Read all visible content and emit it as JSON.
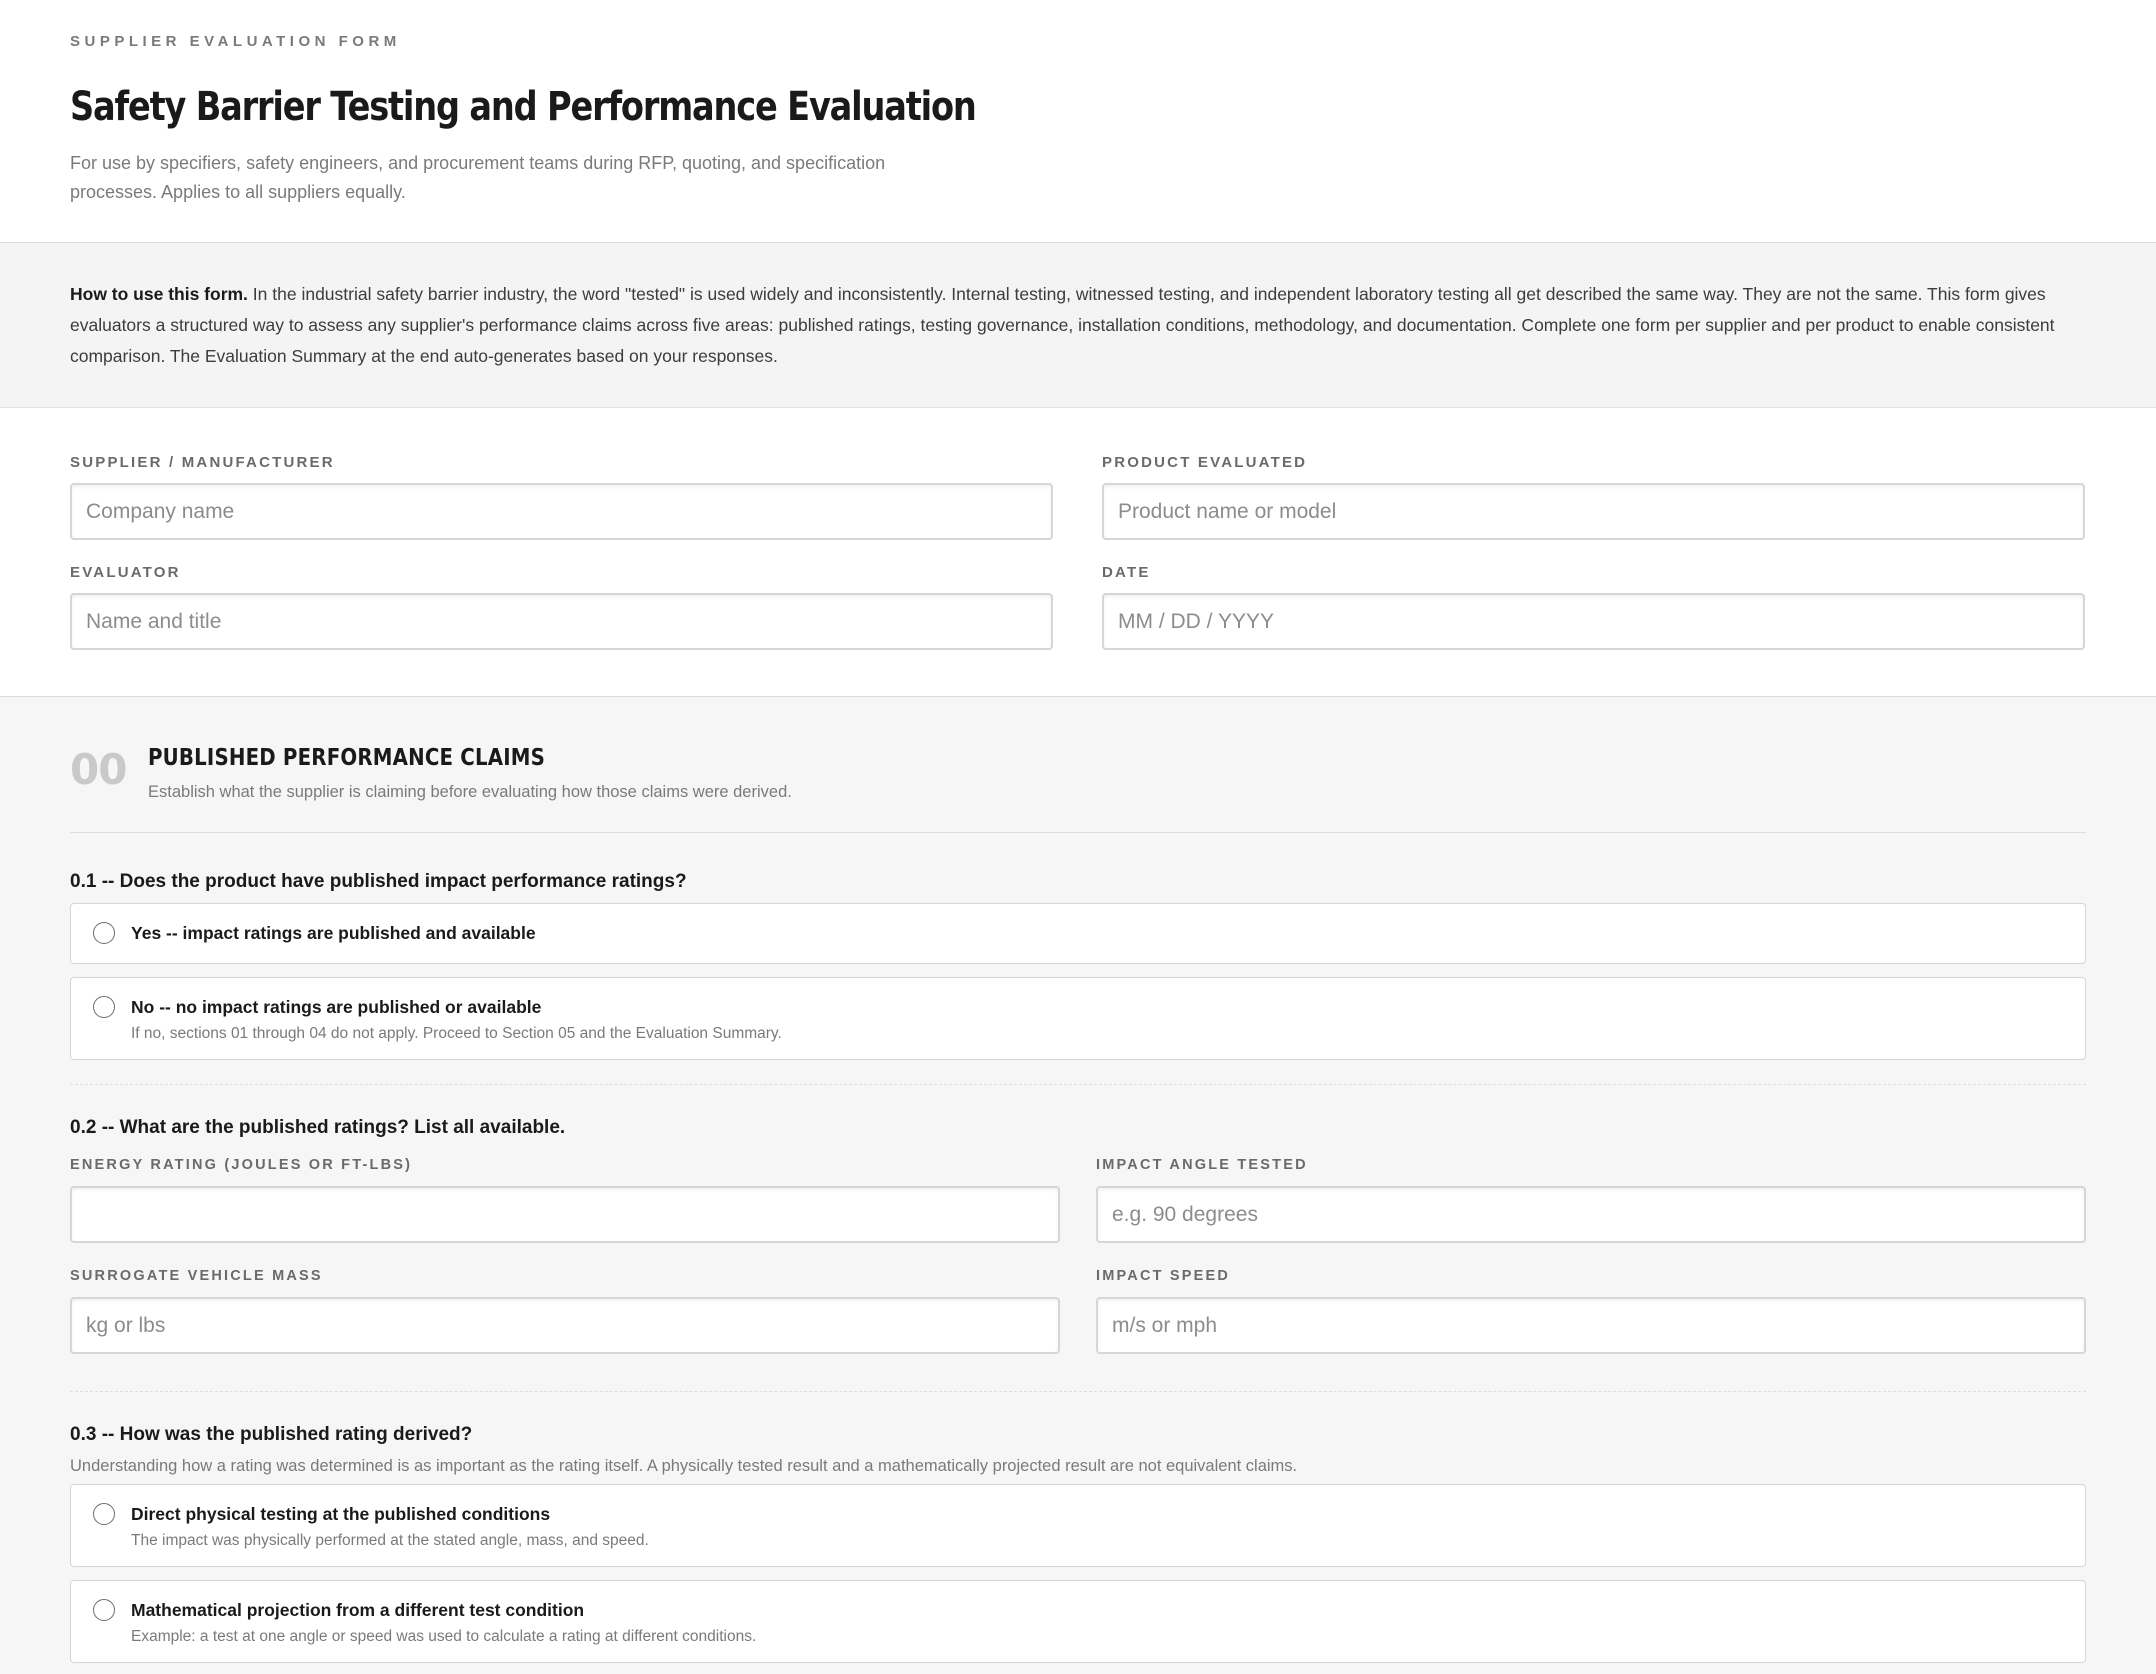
{
  "header": {
    "eyebrow": "SUPPLIER EVALUATION FORM",
    "title": "Safety Barrier Testing and Performance Evaluation",
    "subtitle": "For use by specifiers, safety engineers, and procurement teams during RFP, quoting, and specification processes. Applies to all suppliers equally."
  },
  "howto": {
    "lead": "How to use this form.",
    "body": " In the industrial safety barrier industry, the word \"tested\" is used widely and inconsistently. Internal testing, witnessed testing, and independent laboratory testing all get described the same way. They are not the same. This form gives evaluators a structured way to assess any supplier's performance claims across five areas: published ratings, testing governance, installation conditions, methodology, and documentation. Complete one form per supplier and per product to enable consistent comparison. The Evaluation Summary at the end auto-generates based on your responses."
  },
  "meta": {
    "supplier": {
      "label": "SUPPLIER / MANUFACTURER",
      "placeholder": "Company name",
      "value": ""
    },
    "product": {
      "label": "PRODUCT EVALUATED",
      "placeholder": "Product name or model",
      "value": ""
    },
    "evaluator": {
      "label": "EVALUATOR",
      "placeholder": "Name and title",
      "value": ""
    },
    "date": {
      "label": "DATE",
      "placeholder": "MM / DD / YYYY",
      "value": ""
    }
  },
  "section00": {
    "number": "00",
    "title": "PUBLISHED PERFORMANCE CLAIMS",
    "description": "Establish what the supplier is claiming before evaluating how those claims were derived.",
    "q1": {
      "title": "0.1 -- Does the product have published impact performance ratings?",
      "options": [
        {
          "label": "Yes -- impact ratings are published and available",
          "help": ""
        },
        {
          "label": "No -- no impact ratings are published or available",
          "help": "If no, sections 01 through 04 do not apply. Proceed to Section 05 and the Evaluation Summary."
        }
      ]
    },
    "q2": {
      "title": "0.2 -- What are the published ratings? List all available.",
      "energy": {
        "label": "ENERGY RATING (JOULES OR FT-LBS)",
        "placeholder": "",
        "value": ""
      },
      "angle": {
        "label": "IMPACT ANGLE TESTED",
        "placeholder": "e.g. 90 degrees",
        "value": ""
      },
      "mass": {
        "label": "SURROGATE VEHICLE MASS",
        "placeholder": "kg or lbs",
        "value": ""
      },
      "speed": {
        "label": "IMPACT SPEED",
        "placeholder": "m/s or mph",
        "value": ""
      }
    },
    "q3": {
      "title": "0.3 -- How was the published rating derived?",
      "note": "Understanding how a rating was determined is as important as the rating itself. A physically tested result and a mathematically projected result are not equivalent claims.",
      "options": [
        {
          "label": "Direct physical testing at the published conditions",
          "help": "The impact was physically performed at the stated angle, mass, and speed."
        },
        {
          "label": "Mathematical projection from a different test condition",
          "help": "Example: a test at one angle or speed was used to calculate a rating at different conditions."
        }
      ]
    }
  }
}
